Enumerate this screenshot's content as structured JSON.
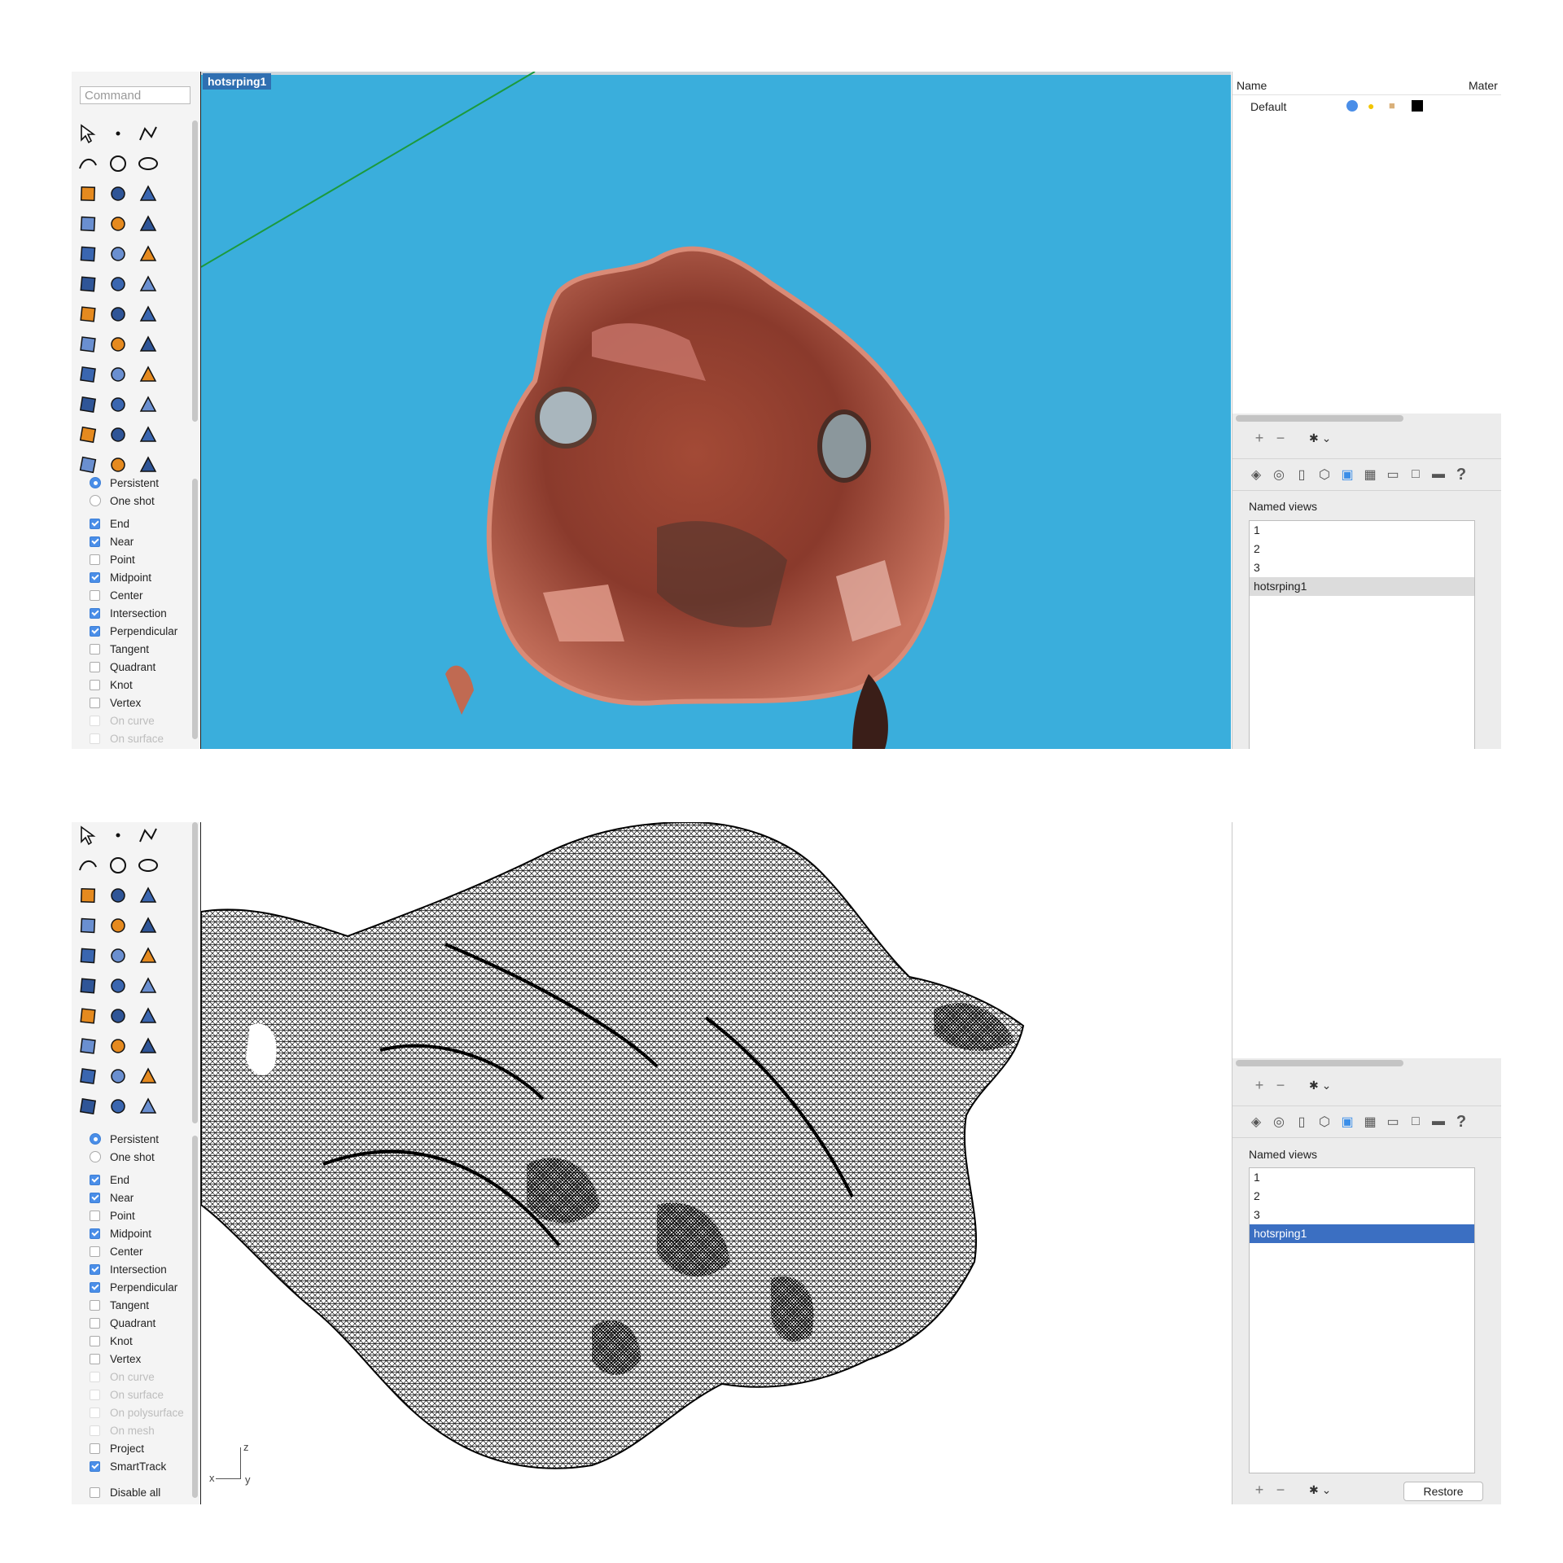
{
  "top_window": {
    "command_placeholder": "Command",
    "viewport_label": "hotsrping1",
    "layers": {
      "name_header": "Name",
      "material_header": "Mater",
      "default_layer": "Default"
    },
    "snap_modes": [
      {
        "label": "Persistent",
        "kind": "radio",
        "checked": true
      },
      {
        "label": "One shot",
        "kind": "radio",
        "checked": false
      }
    ],
    "osnaps": [
      {
        "label": "End",
        "checked": true,
        "disabled": false
      },
      {
        "label": "Near",
        "checked": true,
        "disabled": false
      },
      {
        "label": "Point",
        "checked": false,
        "disabled": false
      },
      {
        "label": "Midpoint",
        "checked": true,
        "disabled": false
      },
      {
        "label": "Center",
        "checked": false,
        "disabled": false
      },
      {
        "label": "Intersection",
        "checked": true,
        "disabled": false
      },
      {
        "label": "Perpendicular",
        "checked": true,
        "disabled": false
      },
      {
        "label": "Tangent",
        "checked": false,
        "disabled": false
      },
      {
        "label": "Quadrant",
        "checked": false,
        "disabled": false
      },
      {
        "label": "Knot",
        "checked": false,
        "disabled": false
      },
      {
        "label": "Vertex",
        "checked": false,
        "disabled": false
      },
      {
        "label": "On curve",
        "checked": false,
        "disabled": true
      },
      {
        "label": "On surface",
        "checked": false,
        "disabled": true
      }
    ],
    "named_views_label": "Named views",
    "named_views": [
      "1",
      "2",
      "3",
      "hotsrping1"
    ]
  },
  "bottom_window": {
    "snap_modes": [
      {
        "label": "Persistent",
        "kind": "radio",
        "checked": true
      },
      {
        "label": "One shot",
        "kind": "radio",
        "checked": false
      }
    ],
    "osnaps": [
      {
        "label": "End",
        "checked": true,
        "disabled": false
      },
      {
        "label": "Near",
        "checked": true,
        "disabled": false
      },
      {
        "label": "Point",
        "checked": false,
        "disabled": false
      },
      {
        "label": "Midpoint",
        "checked": true,
        "disabled": false
      },
      {
        "label": "Center",
        "checked": false,
        "disabled": false
      },
      {
        "label": "Intersection",
        "checked": true,
        "disabled": false
      },
      {
        "label": "Perpendicular",
        "checked": true,
        "disabled": false
      },
      {
        "label": "Tangent",
        "checked": false,
        "disabled": false
      },
      {
        "label": "Quadrant",
        "checked": false,
        "disabled": false
      },
      {
        "label": "Knot",
        "checked": false,
        "disabled": false
      },
      {
        "label": "Vertex",
        "checked": false,
        "disabled": false
      },
      {
        "label": "On curve",
        "checked": false,
        "disabled": true
      },
      {
        "label": "On surface",
        "checked": false,
        "disabled": true
      },
      {
        "label": "On polysurface",
        "checked": false,
        "disabled": true
      },
      {
        "label": "On mesh",
        "checked": false,
        "disabled": true
      },
      {
        "label": "Project",
        "checked": false,
        "disabled": false
      },
      {
        "label": "SmartTrack",
        "checked": true,
        "disabled": false
      }
    ],
    "disable_all": "Disable all",
    "axis_labels": {
      "z": "z",
      "x": "x",
      "y": "y"
    },
    "named_views_label": "Named views",
    "named_views": [
      "1",
      "2",
      "3",
      "hotsrping1"
    ],
    "restore_label": "Restore"
  },
  "toolbar_icons": [
    "select-arrow",
    "point",
    "polyline",
    "curve",
    "circle",
    "ellipse",
    "control-point-curve",
    "rectangle",
    "polygon",
    "fillet-curve",
    "surface-from-points",
    "sweep",
    "box-solid",
    "sphere",
    "cylinder",
    "extrude-surface",
    "explode",
    "boolean",
    "trim",
    "split",
    "boolean-union",
    "group",
    "rotate",
    "arc",
    "text",
    "scale",
    "array",
    "dimension",
    "solid-tools",
    "mesh",
    "grid-snap",
    "gumball",
    "analyze",
    "check",
    "shade",
    "render"
  ],
  "colors": {
    "viewport_blue": "#3aaedc",
    "selection_blue": "#3b6fc2",
    "checkbox_blue": "#4a8ee8"
  }
}
